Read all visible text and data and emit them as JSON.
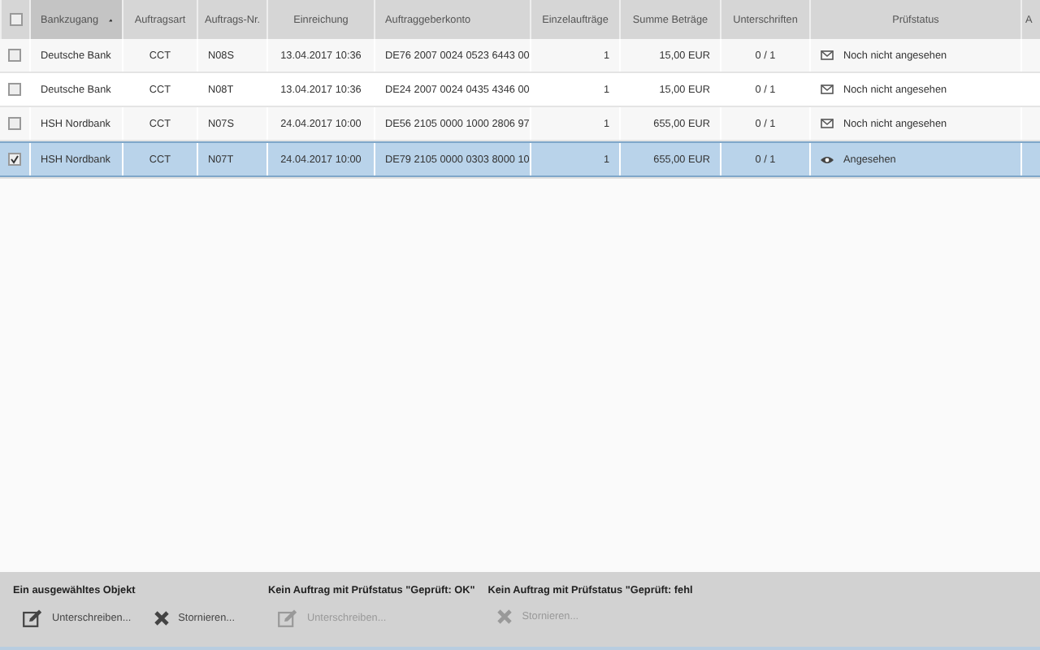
{
  "table": {
    "select_all": {
      "checked": false
    },
    "columns": [
      {
        "label": "Bankzugang",
        "sorted": true
      },
      {
        "label": "Auftragsart",
        "sorted": false
      },
      {
        "label": "Auftrags-Nr.",
        "sorted": false
      },
      {
        "label": "Einreichung",
        "sorted": false
      },
      {
        "label": "Auftraggeberkonto",
        "sorted": false
      },
      {
        "label": "Einzelaufträge",
        "sorted": false
      },
      {
        "label": "Summe Beträge",
        "sorted": false
      },
      {
        "label": "Unterschriften",
        "sorted": false
      },
      {
        "label": "Prüfstatus",
        "sorted": false
      },
      {
        "label": "A",
        "sorted": false
      }
    ],
    "rows": [
      {
        "selected": false,
        "bank": "Deutsche Bank",
        "type": "CCT",
        "number": "N08S",
        "submitted": "13.04.2017 10:36",
        "account": "DE76 2007 0024 0523 6443 00",
        "orders": "1",
        "total": "15,00 EUR",
        "signatures": "0 / 1",
        "status": {
          "kind": "unseen",
          "label": "Noch nicht angesehen"
        }
      },
      {
        "selected": false,
        "bank": "Deutsche Bank",
        "type": "CCT",
        "number": "N08T",
        "submitted": "13.04.2017 10:36",
        "account": "DE24 2007 0024 0435 4346 00",
        "orders": "1",
        "total": "15,00 EUR",
        "signatures": "0 / 1",
        "status": {
          "kind": "unseen",
          "label": "Noch nicht angesehen"
        }
      },
      {
        "selected": false,
        "bank": "HSH Nordbank",
        "type": "CCT",
        "number": "N07S",
        "submitted": "24.04.2017 10:00",
        "account": "DE56 2105 0000 1000 2806 97",
        "orders": "1",
        "total": "655,00 EUR",
        "signatures": "0 / 1",
        "status": {
          "kind": "unseen",
          "label": "Noch nicht angesehen"
        }
      },
      {
        "selected": true,
        "bank": "HSH Nordbank",
        "type": "CCT",
        "number": "N07T",
        "submitted": "24.04.2017 10:00",
        "account": "DE79 2105 0000 0303 8000 10",
        "orders": "1",
        "total": "655,00 EUR",
        "signatures": "0 / 1",
        "status": {
          "kind": "seen",
          "label": "Angesehen"
        }
      }
    ]
  },
  "footer": {
    "sections": [
      {
        "title": "Ein ausgewähltes Objekt",
        "actions": [
          {
            "kind": "sign",
            "label": "Unterschreiben...",
            "disabled": false
          },
          {
            "kind": "cancel",
            "label": "Stornieren...",
            "disabled": false
          }
        ]
      },
      {
        "title": "Kein Auftrag mit Prüfstatus \"Geprüft: OK\"",
        "actions": [
          {
            "kind": "sign",
            "label": "Unterschreiben...",
            "disabled": true
          }
        ]
      },
      {
        "title": "Kein Auftrag mit Prüfstatus \"Geprüft: fehl",
        "actions": [
          {
            "kind": "cancel",
            "label": "Stornieren...",
            "disabled": true
          }
        ]
      }
    ]
  }
}
